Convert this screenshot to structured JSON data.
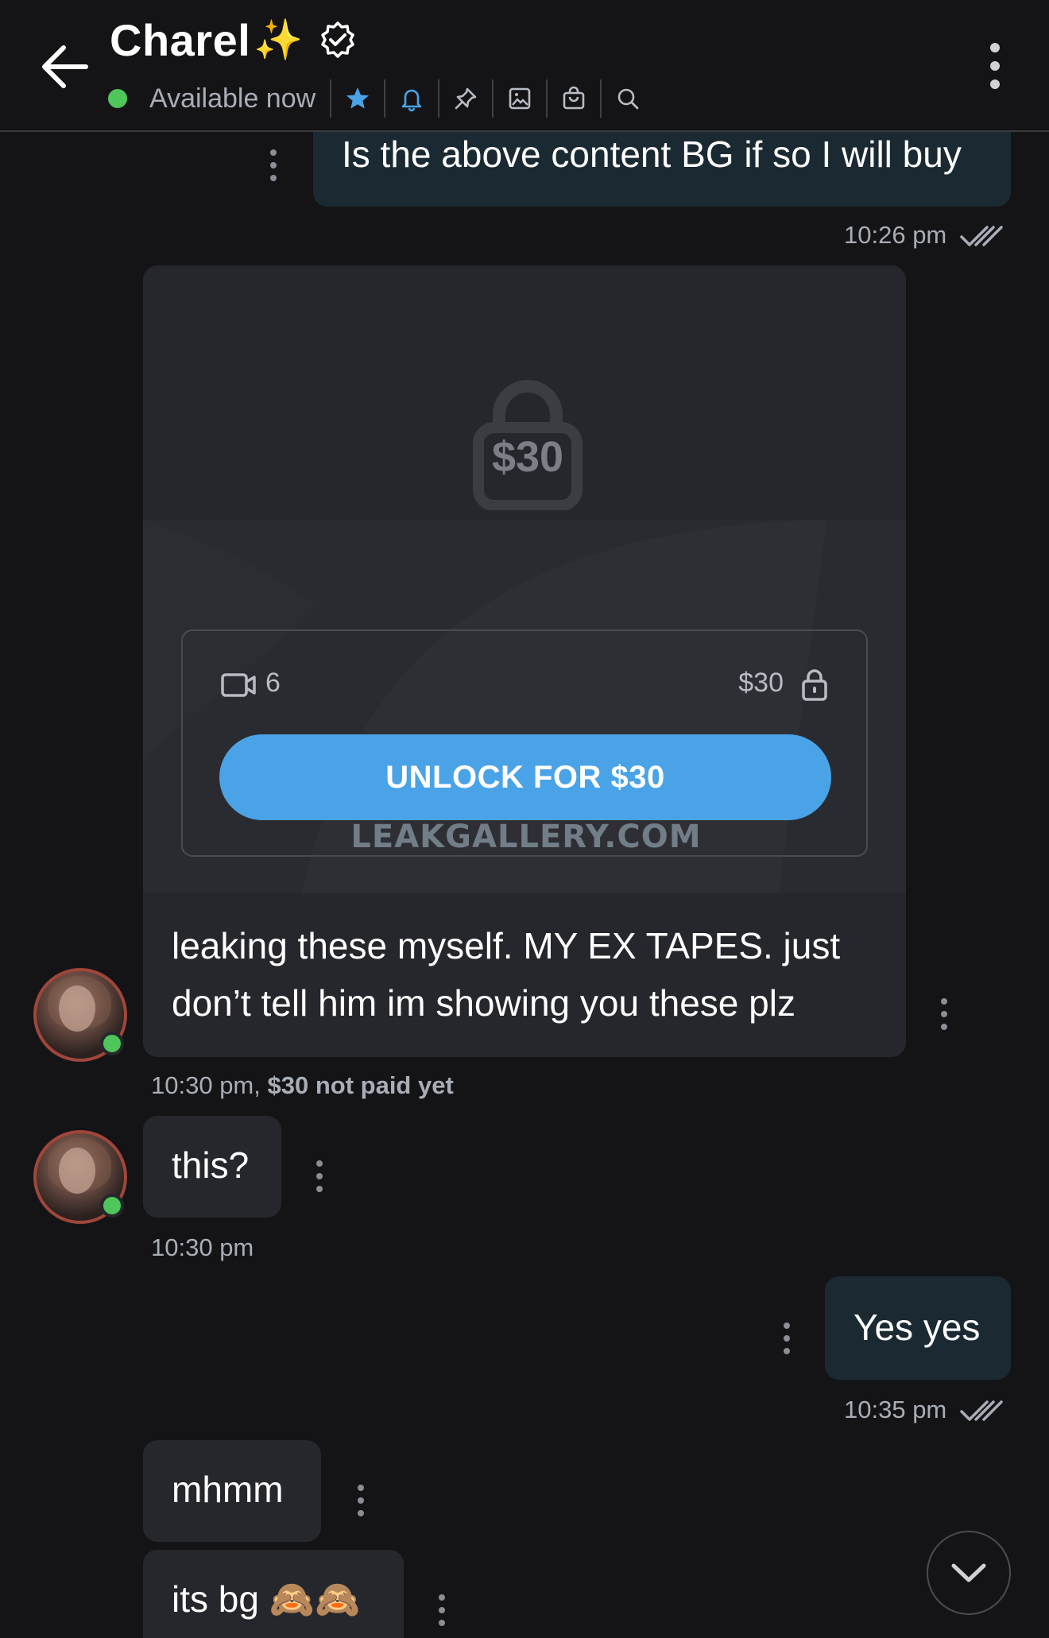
{
  "header": {
    "title": "Charel",
    "title_emoji": "✨",
    "status": "Available now",
    "icons": [
      "back-arrow-icon",
      "verified-badge-icon",
      "star-icon",
      "bell-icon",
      "pin-icon",
      "image-icon",
      "bag-icon",
      "search-icon",
      "more-vertical-icon"
    ]
  },
  "colors": {
    "background": "#141417",
    "outgoing_bubble": "#1b2a32",
    "incoming_bubble": "#26272c",
    "accent_blue": "#4aa3e6",
    "online_green": "#4fc65a",
    "muted_text": "#a9adb6"
  },
  "messages": [
    {
      "id": "m1",
      "direction": "out",
      "text": "Is the above content BG if so I will buy",
      "time": "10:26 pm",
      "read": true
    },
    {
      "id": "m2",
      "direction": "in",
      "type": "locked-media",
      "lock_price": "$30",
      "video_count": "6",
      "box_price": "$30",
      "unlock_label": "UNLOCK FOR $30",
      "watermark": "LEAKGALLERY.COM",
      "caption": "leaking these myself. MY EX TAPES. just don’t tell him im showing you these plz",
      "time": "10:30 pm,",
      "payment_status": "$30 not paid yet"
    },
    {
      "id": "m3",
      "direction": "in",
      "text": "this?",
      "time": "10:30 pm"
    },
    {
      "id": "m4",
      "direction": "out",
      "text": "Yes yes",
      "time": "10:35 pm",
      "read": true
    },
    {
      "id": "m5",
      "direction": "in",
      "text": "mhmm"
    },
    {
      "id": "m6",
      "direction": "in",
      "text": "its bg",
      "emoji": "🙈🙈"
    }
  ]
}
